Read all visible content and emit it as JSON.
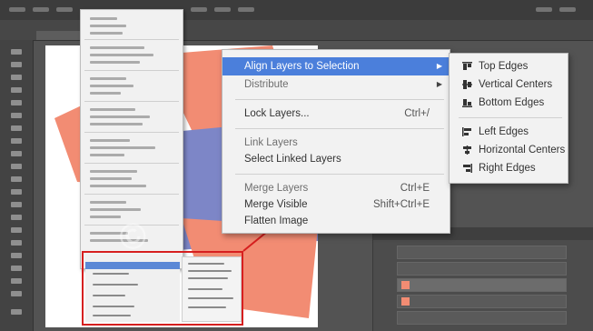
{
  "zoom_menu": {
    "items": [
      {
        "label": "Align Layers to Selection",
        "shortcut": "",
        "has_submenu": true,
        "active": true,
        "dim": false
      },
      {
        "label": "Distribute",
        "shortcut": "",
        "has_submenu": true,
        "active": false,
        "dim": true
      },
      {
        "label": "Lock Layers...",
        "shortcut": "Ctrl+/",
        "has_submenu": false,
        "active": false,
        "dim": false
      },
      {
        "label": "Link Layers",
        "shortcut": "",
        "has_submenu": false,
        "active": false,
        "dim": true
      },
      {
        "label": "Select Linked Layers",
        "shortcut": "",
        "has_submenu": false,
        "active": false,
        "dim": false
      },
      {
        "label": "Merge Layers",
        "shortcut": "Ctrl+E",
        "has_submenu": false,
        "active": false,
        "dim": true
      },
      {
        "label": "Merge Visible",
        "shortcut": "Shift+Ctrl+E",
        "has_submenu": false,
        "active": false,
        "dim": false
      },
      {
        "label": "Flatten Image",
        "shortcut": "",
        "has_submenu": false,
        "active": false,
        "dim": false
      }
    ]
  },
  "align_submenu": {
    "items": [
      {
        "label": "Top Edges",
        "icon": "align-top-edges-icon"
      },
      {
        "label": "Vertical Centers",
        "icon": "align-vertical-centers-icon"
      },
      {
        "label": "Bottom Edges",
        "icon": "align-bottom-edges-icon"
      },
      {
        "label": "Left Edges",
        "icon": "align-left-edges-icon"
      },
      {
        "label": "Horizontal Centers",
        "icon": "align-horizontal-centers-icon"
      },
      {
        "label": "Right Edges",
        "icon": "align-right-edges-icon"
      }
    ]
  },
  "colors": {
    "highlight": "#4b7fdb",
    "callout_border": "#d61f1f",
    "shape_salmon": "#f28c73",
    "shape_blue": "#7d86c7"
  }
}
